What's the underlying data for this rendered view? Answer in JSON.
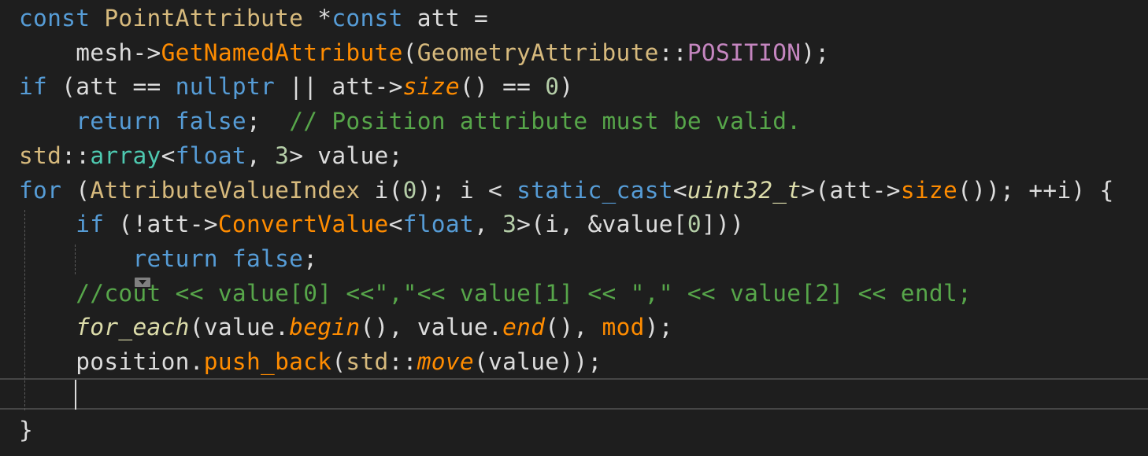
{
  "editor": {
    "lines": [
      {
        "tokens": [
          {
            "t": "const ",
            "c": "kw"
          },
          {
            "t": "PointAttribute",
            "c": "cls"
          },
          {
            "t": " *",
            "c": "pl"
          },
          {
            "t": "const",
            "c": "kw"
          },
          {
            "t": " att =",
            "c": "pl"
          }
        ]
      },
      {
        "tokens": [
          {
            "t": "    mesh->",
            "c": "pl"
          },
          {
            "t": "GetNamedAttribute",
            "c": "fn"
          },
          {
            "t": "(",
            "c": "pl"
          },
          {
            "t": "GeometryAttribute",
            "c": "cls"
          },
          {
            "t": "::",
            "c": "pl"
          },
          {
            "t": "POSITION",
            "c": "enum"
          },
          {
            "t": ");",
            "c": "pl"
          }
        ]
      },
      {
        "tokens": [
          {
            "t": "if",
            "c": "kw"
          },
          {
            "t": " (att == ",
            "c": "pl"
          },
          {
            "t": "nullptr",
            "c": "kw"
          },
          {
            "t": " || att->",
            "c": "pl"
          },
          {
            "t": "size",
            "c": "fni"
          },
          {
            "t": "() == ",
            "c": "pl"
          },
          {
            "t": "0",
            "c": "num"
          },
          {
            "t": ")",
            "c": "pl"
          }
        ]
      },
      {
        "tokens": [
          {
            "t": "    ",
            "c": "pl"
          },
          {
            "t": "return",
            "c": "kw"
          },
          {
            "t": " ",
            "c": "pl"
          },
          {
            "t": "false",
            "c": "kw"
          },
          {
            "t": ";  ",
            "c": "pl"
          },
          {
            "t": "// Position attribute must be valid.",
            "c": "cm"
          }
        ]
      },
      {
        "tokens": [
          {
            "t": "std",
            "c": "ns"
          },
          {
            "t": "::",
            "c": "pl"
          },
          {
            "t": "array",
            "c": "type"
          },
          {
            "t": "<",
            "c": "pl"
          },
          {
            "t": "float",
            "c": "kw"
          },
          {
            "t": ", ",
            "c": "pl"
          },
          {
            "t": "3",
            "c": "num"
          },
          {
            "t": "> value;",
            "c": "pl"
          }
        ]
      },
      {
        "tokens": [
          {
            "t": "for",
            "c": "kw"
          },
          {
            "t": " (",
            "c": "pl"
          },
          {
            "t": "AttributeValueIndex",
            "c": "cls"
          },
          {
            "t": " i(",
            "c": "pl"
          },
          {
            "t": "0",
            "c": "num"
          },
          {
            "t": "); i < ",
            "c": "pl"
          },
          {
            "t": "static_cast",
            "c": "kw"
          },
          {
            "t": "<",
            "c": "pl"
          },
          {
            "t": "uint32_t",
            "c": "typei"
          },
          {
            "t": ">(att->",
            "c": "pl"
          },
          {
            "t": "size",
            "c": "fn"
          },
          {
            "t": "()); ++i) {",
            "c": "pl"
          }
        ]
      },
      {
        "tokens": [
          {
            "t": "    ",
            "c": "pl"
          },
          {
            "t": "if",
            "c": "kw"
          },
          {
            "t": " (!att->",
            "c": "pl"
          },
          {
            "t": "ConvertValue",
            "c": "fn"
          },
          {
            "t": "<",
            "c": "pl"
          },
          {
            "t": "float",
            "c": "kw"
          },
          {
            "t": ", ",
            "c": "pl"
          },
          {
            "t": "3",
            "c": "num"
          },
          {
            "t": ">(i, &value[",
            "c": "pl"
          },
          {
            "t": "0",
            "c": "num"
          },
          {
            "t": "]))",
            "c": "pl"
          }
        ]
      },
      {
        "tokens": [
          {
            "t": "        ",
            "c": "pl"
          },
          {
            "t": "return",
            "c": "kw"
          },
          {
            "t": " ",
            "c": "pl"
          },
          {
            "t": "false",
            "c": "kw"
          },
          {
            "t": ";",
            "c": "pl"
          }
        ]
      },
      {
        "tokens": [
          {
            "t": "    ",
            "c": "pl"
          },
          {
            "t": "//cout << value[0] <<\",\"<< value[1] << \",\" << value[2] << endl;",
            "c": "cm"
          }
        ]
      },
      {
        "tokens": [
          {
            "t": "    ",
            "c": "pl"
          },
          {
            "t": "for_each",
            "c": "typei"
          },
          {
            "t": "(value.",
            "c": "pl"
          },
          {
            "t": "begin",
            "c": "fni"
          },
          {
            "t": "(), value.",
            "c": "pl"
          },
          {
            "t": "end",
            "c": "fni"
          },
          {
            "t": "(), ",
            "c": "pl"
          },
          {
            "t": "mod",
            "c": "fn"
          },
          {
            "t": ");",
            "c": "pl"
          }
        ]
      },
      {
        "tokens": [
          {
            "t": "    position.",
            "c": "pl"
          },
          {
            "t": "push_back",
            "c": "fn"
          },
          {
            "t": "(",
            "c": "pl"
          },
          {
            "t": "std",
            "c": "ns"
          },
          {
            "t": "::",
            "c": "pl"
          },
          {
            "t": "move",
            "c": "fni"
          },
          {
            "t": "(value));",
            "c": "pl"
          }
        ]
      },
      {
        "tokens": [
          {
            "t": "",
            "c": "pl"
          }
        ]
      },
      {
        "tokens": [
          {
            "t": "}",
            "c": "pl"
          }
        ]
      }
    ]
  }
}
